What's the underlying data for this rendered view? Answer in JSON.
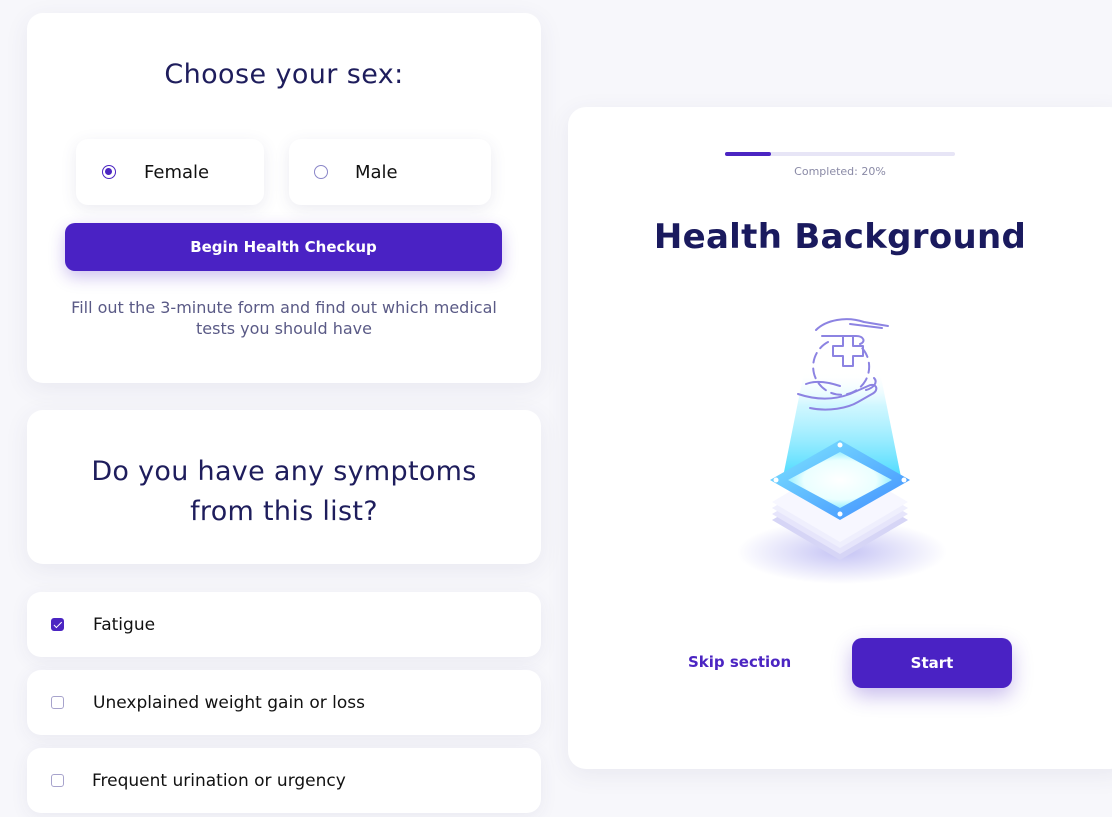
{
  "sex_card": {
    "title": "Choose your sex:",
    "options": [
      {
        "label": "Female",
        "selected": true
      },
      {
        "label": "Male",
        "selected": false
      }
    ],
    "button_label": "Begin Health Checkup",
    "description": "Fill out the 3-minute form and find out which medical tests you should have"
  },
  "symptoms_card": {
    "title": "Do you have any symptoms from this list?"
  },
  "symptoms": [
    {
      "label": "Fatigue",
      "checked": true
    },
    {
      "label": "Unexplained weight gain or loss",
      "checked": false
    },
    {
      "label": "Frequent urination or urgency",
      "checked": false
    }
  ],
  "health_card": {
    "progress_text": "Completed: 20%",
    "progress_fraction": 0.2,
    "title": "Health Background",
    "illustration_icon": "health-care-hand-icon",
    "skip_label": "Skip section",
    "start_label": "Start"
  },
  "colors": {
    "accent": "#4a22c4",
    "title_text": "#1a1a5e",
    "muted_text": "#5a5a86",
    "background": "#f7f7fb"
  }
}
